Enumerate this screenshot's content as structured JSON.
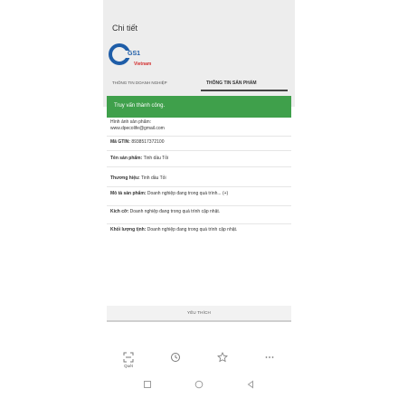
{
  "header": {
    "title": "Chi tiết",
    "logo_text": "GS1",
    "logo_sub": "Vietnam"
  },
  "tabs": [
    {
      "label": "THÔNG TIN DOANH NGHIỆP"
    },
    {
      "label": "THÔNG TIN SẢN PHẨM"
    }
  ],
  "toast": {
    "text": "Truy vấn thành công."
  },
  "details": {
    "image_label": "Hình ảnh sản phẩm:",
    "image_value": "www.dpecolife@gmail.com",
    "gtin_label": "Mã GTIN:",
    "gtin_value": "8938517372100",
    "name_label": "Tên sản phẩm:",
    "name_value": "Tinh dầu Tỏi",
    "brand_label": "Thương hiệu:",
    "brand_value": "Tinh dầu Tỏi",
    "desc_label": "Mô tả sản phẩm:",
    "desc_value": "Doanh nghiệp đang trong quá trình... (+)",
    "size_label": "Kích cỡ:",
    "size_value": "Doanh nghiệp đang trong quá trình cập nhật.",
    "weight_label": "Khối lượng tịnh:",
    "weight_value": "Doanh nghiệp đang trong quá trình cập nhật."
  },
  "favorite_button": {
    "label": "YÊU THÍCH"
  },
  "bottom_nav": [
    {
      "label": "Quét",
      "icon": "scan-icon"
    },
    {
      "label": "",
      "icon": "history-icon"
    },
    {
      "label": "",
      "icon": "star-icon"
    },
    {
      "label": "",
      "icon": "more-icon"
    }
  ],
  "system_nav": [
    "recent-apps-icon",
    "home-icon",
    "back-icon"
  ]
}
